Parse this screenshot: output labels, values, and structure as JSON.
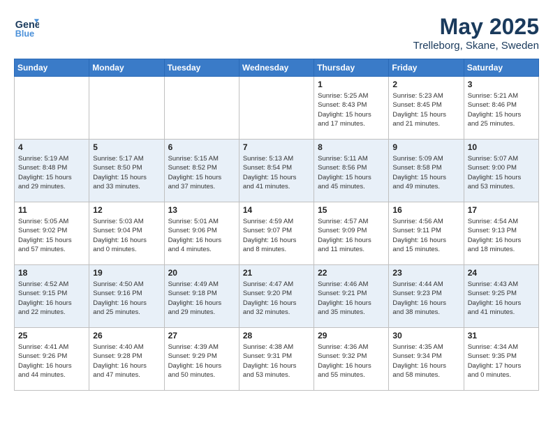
{
  "header": {
    "logo_line1": "General",
    "logo_line2": "Blue",
    "month": "May 2025",
    "location": "Trelleborg, Skane, Sweden"
  },
  "weekdays": [
    "Sunday",
    "Monday",
    "Tuesday",
    "Wednesday",
    "Thursday",
    "Friday",
    "Saturday"
  ],
  "weeks": [
    [
      {
        "day": "",
        "info": ""
      },
      {
        "day": "",
        "info": ""
      },
      {
        "day": "",
        "info": ""
      },
      {
        "day": "",
        "info": ""
      },
      {
        "day": "1",
        "info": "Sunrise: 5:25 AM\nSunset: 8:43 PM\nDaylight: 15 hours\nand 17 minutes."
      },
      {
        "day": "2",
        "info": "Sunrise: 5:23 AM\nSunset: 8:45 PM\nDaylight: 15 hours\nand 21 minutes."
      },
      {
        "day": "3",
        "info": "Sunrise: 5:21 AM\nSunset: 8:46 PM\nDaylight: 15 hours\nand 25 minutes."
      }
    ],
    [
      {
        "day": "4",
        "info": "Sunrise: 5:19 AM\nSunset: 8:48 PM\nDaylight: 15 hours\nand 29 minutes."
      },
      {
        "day": "5",
        "info": "Sunrise: 5:17 AM\nSunset: 8:50 PM\nDaylight: 15 hours\nand 33 minutes."
      },
      {
        "day": "6",
        "info": "Sunrise: 5:15 AM\nSunset: 8:52 PM\nDaylight: 15 hours\nand 37 minutes."
      },
      {
        "day": "7",
        "info": "Sunrise: 5:13 AM\nSunset: 8:54 PM\nDaylight: 15 hours\nand 41 minutes."
      },
      {
        "day": "8",
        "info": "Sunrise: 5:11 AM\nSunset: 8:56 PM\nDaylight: 15 hours\nand 45 minutes."
      },
      {
        "day": "9",
        "info": "Sunrise: 5:09 AM\nSunset: 8:58 PM\nDaylight: 15 hours\nand 49 minutes."
      },
      {
        "day": "10",
        "info": "Sunrise: 5:07 AM\nSunset: 9:00 PM\nDaylight: 15 hours\nand 53 minutes."
      }
    ],
    [
      {
        "day": "11",
        "info": "Sunrise: 5:05 AM\nSunset: 9:02 PM\nDaylight: 15 hours\nand 57 minutes."
      },
      {
        "day": "12",
        "info": "Sunrise: 5:03 AM\nSunset: 9:04 PM\nDaylight: 16 hours\nand 0 minutes."
      },
      {
        "day": "13",
        "info": "Sunrise: 5:01 AM\nSunset: 9:06 PM\nDaylight: 16 hours\nand 4 minutes."
      },
      {
        "day": "14",
        "info": "Sunrise: 4:59 AM\nSunset: 9:07 PM\nDaylight: 16 hours\nand 8 minutes."
      },
      {
        "day": "15",
        "info": "Sunrise: 4:57 AM\nSunset: 9:09 PM\nDaylight: 16 hours\nand 11 minutes."
      },
      {
        "day": "16",
        "info": "Sunrise: 4:56 AM\nSunset: 9:11 PM\nDaylight: 16 hours\nand 15 minutes."
      },
      {
        "day": "17",
        "info": "Sunrise: 4:54 AM\nSunset: 9:13 PM\nDaylight: 16 hours\nand 18 minutes."
      }
    ],
    [
      {
        "day": "18",
        "info": "Sunrise: 4:52 AM\nSunset: 9:15 PM\nDaylight: 16 hours\nand 22 minutes."
      },
      {
        "day": "19",
        "info": "Sunrise: 4:50 AM\nSunset: 9:16 PM\nDaylight: 16 hours\nand 25 minutes."
      },
      {
        "day": "20",
        "info": "Sunrise: 4:49 AM\nSunset: 9:18 PM\nDaylight: 16 hours\nand 29 minutes."
      },
      {
        "day": "21",
        "info": "Sunrise: 4:47 AM\nSunset: 9:20 PM\nDaylight: 16 hours\nand 32 minutes."
      },
      {
        "day": "22",
        "info": "Sunrise: 4:46 AM\nSunset: 9:21 PM\nDaylight: 16 hours\nand 35 minutes."
      },
      {
        "day": "23",
        "info": "Sunrise: 4:44 AM\nSunset: 9:23 PM\nDaylight: 16 hours\nand 38 minutes."
      },
      {
        "day": "24",
        "info": "Sunrise: 4:43 AM\nSunset: 9:25 PM\nDaylight: 16 hours\nand 41 minutes."
      }
    ],
    [
      {
        "day": "25",
        "info": "Sunrise: 4:41 AM\nSunset: 9:26 PM\nDaylight: 16 hours\nand 44 minutes."
      },
      {
        "day": "26",
        "info": "Sunrise: 4:40 AM\nSunset: 9:28 PM\nDaylight: 16 hours\nand 47 minutes."
      },
      {
        "day": "27",
        "info": "Sunrise: 4:39 AM\nSunset: 9:29 PM\nDaylight: 16 hours\nand 50 minutes."
      },
      {
        "day": "28",
        "info": "Sunrise: 4:38 AM\nSunset: 9:31 PM\nDaylight: 16 hours\nand 53 minutes."
      },
      {
        "day": "29",
        "info": "Sunrise: 4:36 AM\nSunset: 9:32 PM\nDaylight: 16 hours\nand 55 minutes."
      },
      {
        "day": "30",
        "info": "Sunrise: 4:35 AM\nSunset: 9:34 PM\nDaylight: 16 hours\nand 58 minutes."
      },
      {
        "day": "31",
        "info": "Sunrise: 4:34 AM\nSunset: 9:35 PM\nDaylight: 17 hours\nand 0 minutes."
      }
    ]
  ]
}
